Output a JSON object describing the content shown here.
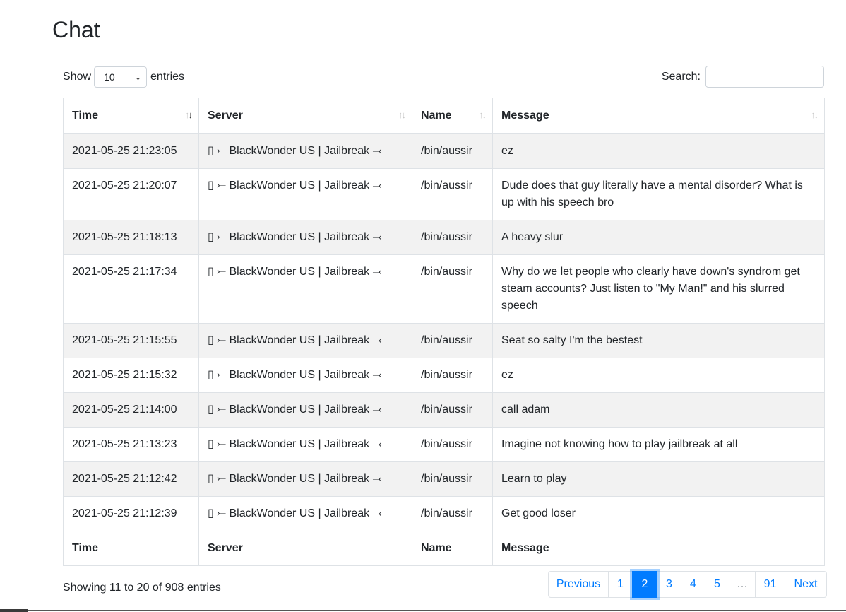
{
  "page": {
    "title": "Chat"
  },
  "length": {
    "show_label": "Show",
    "value": "10",
    "entries_label": "entries"
  },
  "search": {
    "label": "Search:",
    "value": "",
    "placeholder": ""
  },
  "table": {
    "columns": [
      "Time",
      "Server",
      "Name",
      "Message"
    ],
    "rows": [
      {
        "time": "2021-05-25 21:23:05",
        "server": "▯ ⤚ BlackWonder US | Jailbreak ⤙",
        "name": "/bin/aussir",
        "message": "ez"
      },
      {
        "time": "2021-05-25 21:20:07",
        "server": "▯ ⤚ BlackWonder US | Jailbreak ⤙",
        "name": "/bin/aussir",
        "message": "Dude does that guy literally have a mental disorder? What is up with his speech bro"
      },
      {
        "time": "2021-05-25 21:18:13",
        "server": "▯ ⤚ BlackWonder US | Jailbreak ⤙",
        "name": "/bin/aussir",
        "message": "A heavy slur"
      },
      {
        "time": "2021-05-25 21:17:34",
        "server": "▯ ⤚ BlackWonder US | Jailbreak ⤙",
        "name": "/bin/aussir",
        "message": "Why do we let people who clearly have down's syndrom get steam accounts? Just listen to \"My Man!\" and his slurred speech"
      },
      {
        "time": "2021-05-25 21:15:55",
        "server": "▯ ⤚ BlackWonder US | Jailbreak ⤙",
        "name": "/bin/aussir",
        "message": "Seat so salty I'm the bestest"
      },
      {
        "time": "2021-05-25 21:15:32",
        "server": "▯ ⤚ BlackWonder US | Jailbreak ⤙",
        "name": "/bin/aussir",
        "message": "ez"
      },
      {
        "time": "2021-05-25 21:14:00",
        "server": "▯ ⤚ BlackWonder US | Jailbreak ⤙",
        "name": "/bin/aussir",
        "message": "call adam"
      },
      {
        "time": "2021-05-25 21:13:23",
        "server": "▯ ⤚ BlackWonder US | Jailbreak ⤙",
        "name": "/bin/aussir",
        "message": "Imagine not knowing how to play jailbreak at all"
      },
      {
        "time": "2021-05-25 21:12:42",
        "server": "▯ ⤚ BlackWonder US | Jailbreak ⤙",
        "name": "/bin/aussir",
        "message": "Learn to play"
      },
      {
        "time": "2021-05-25 21:12:39",
        "server": "▯ ⤚ BlackWonder US | Jailbreak ⤙",
        "name": "/bin/aussir",
        "message": "Get good loser"
      }
    ]
  },
  "info": "Showing 11 to 20 of 908 entries",
  "pagination": {
    "previous": "Previous",
    "pages": [
      "1",
      "2",
      "3",
      "4",
      "5",
      "…",
      "91"
    ],
    "current": "2",
    "next": "Next"
  },
  "colors": {
    "accent": "#007bff",
    "stripe": "#f2f2f2",
    "border": "#dee2e6"
  }
}
